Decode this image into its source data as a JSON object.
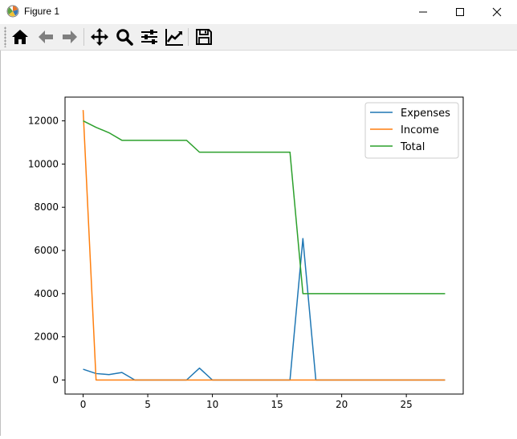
{
  "window": {
    "title": "Figure 1",
    "icon": "matplotlib-icon",
    "controls": [
      "minimize-icon",
      "maximize-icon",
      "close-icon"
    ]
  },
  "toolbar": {
    "buttons": [
      {
        "name": "home",
        "icon": "home-icon"
      },
      {
        "name": "back",
        "icon": "arrow-left-icon"
      },
      {
        "name": "forward",
        "icon": "arrow-right-icon"
      },
      {
        "name": "pan",
        "icon": "move-icon"
      },
      {
        "name": "zoom",
        "icon": "zoom-icon"
      },
      {
        "name": "subplots",
        "icon": "sliders-icon"
      },
      {
        "name": "customize",
        "icon": "line-chart-icon"
      },
      {
        "name": "save",
        "icon": "save-icon"
      }
    ]
  },
  "chart_data": {
    "type": "line",
    "title": "",
    "xlabel": "",
    "ylabel": "",
    "xlim": [
      -1.4,
      29.4
    ],
    "ylim": [
      -650,
      13100
    ],
    "x_ticks": [
      0,
      5,
      10,
      15,
      20,
      25
    ],
    "y_ticks": [
      0,
      2000,
      4000,
      6000,
      8000,
      10000,
      12000
    ],
    "grid": false,
    "legend": "top-right",
    "x": [
      0,
      1,
      2,
      3,
      4,
      5,
      6,
      7,
      8,
      9,
      10,
      11,
      12,
      13,
      14,
      15,
      16,
      17,
      18,
      19,
      20,
      21,
      22,
      23,
      24,
      25,
      26,
      27,
      28
    ],
    "series": [
      {
        "name": "Expenses",
        "color": "#1f77b4",
        "values": [
          500,
          300,
          250,
          350,
          0,
          0,
          0,
          0,
          0,
          550,
          0,
          0,
          0,
          0,
          0,
          0,
          0,
          6550,
          0,
          0,
          0,
          0,
          0,
          0,
          0,
          0,
          0,
          0,
          0
        ]
      },
      {
        "name": "Income",
        "color": "#ff7f0e",
        "values": [
          12500,
          0,
          0,
          0,
          0,
          0,
          0,
          0,
          0,
          0,
          0,
          0,
          0,
          0,
          0,
          0,
          0,
          0,
          0,
          0,
          0,
          0,
          0,
          0,
          0,
          0,
          0,
          0,
          0
        ]
      },
      {
        "name": "Total",
        "color": "#2ca02c",
        "values": [
          12000,
          11700,
          11450,
          11100,
          11100,
          11100,
          11100,
          11100,
          11100,
          10550,
          10550,
          10550,
          10550,
          10550,
          10550,
          10550,
          10550,
          4000,
          4000,
          4000,
          4000,
          4000,
          4000,
          4000,
          4000,
          4000,
          4000,
          4000,
          4000
        ]
      }
    ]
  }
}
